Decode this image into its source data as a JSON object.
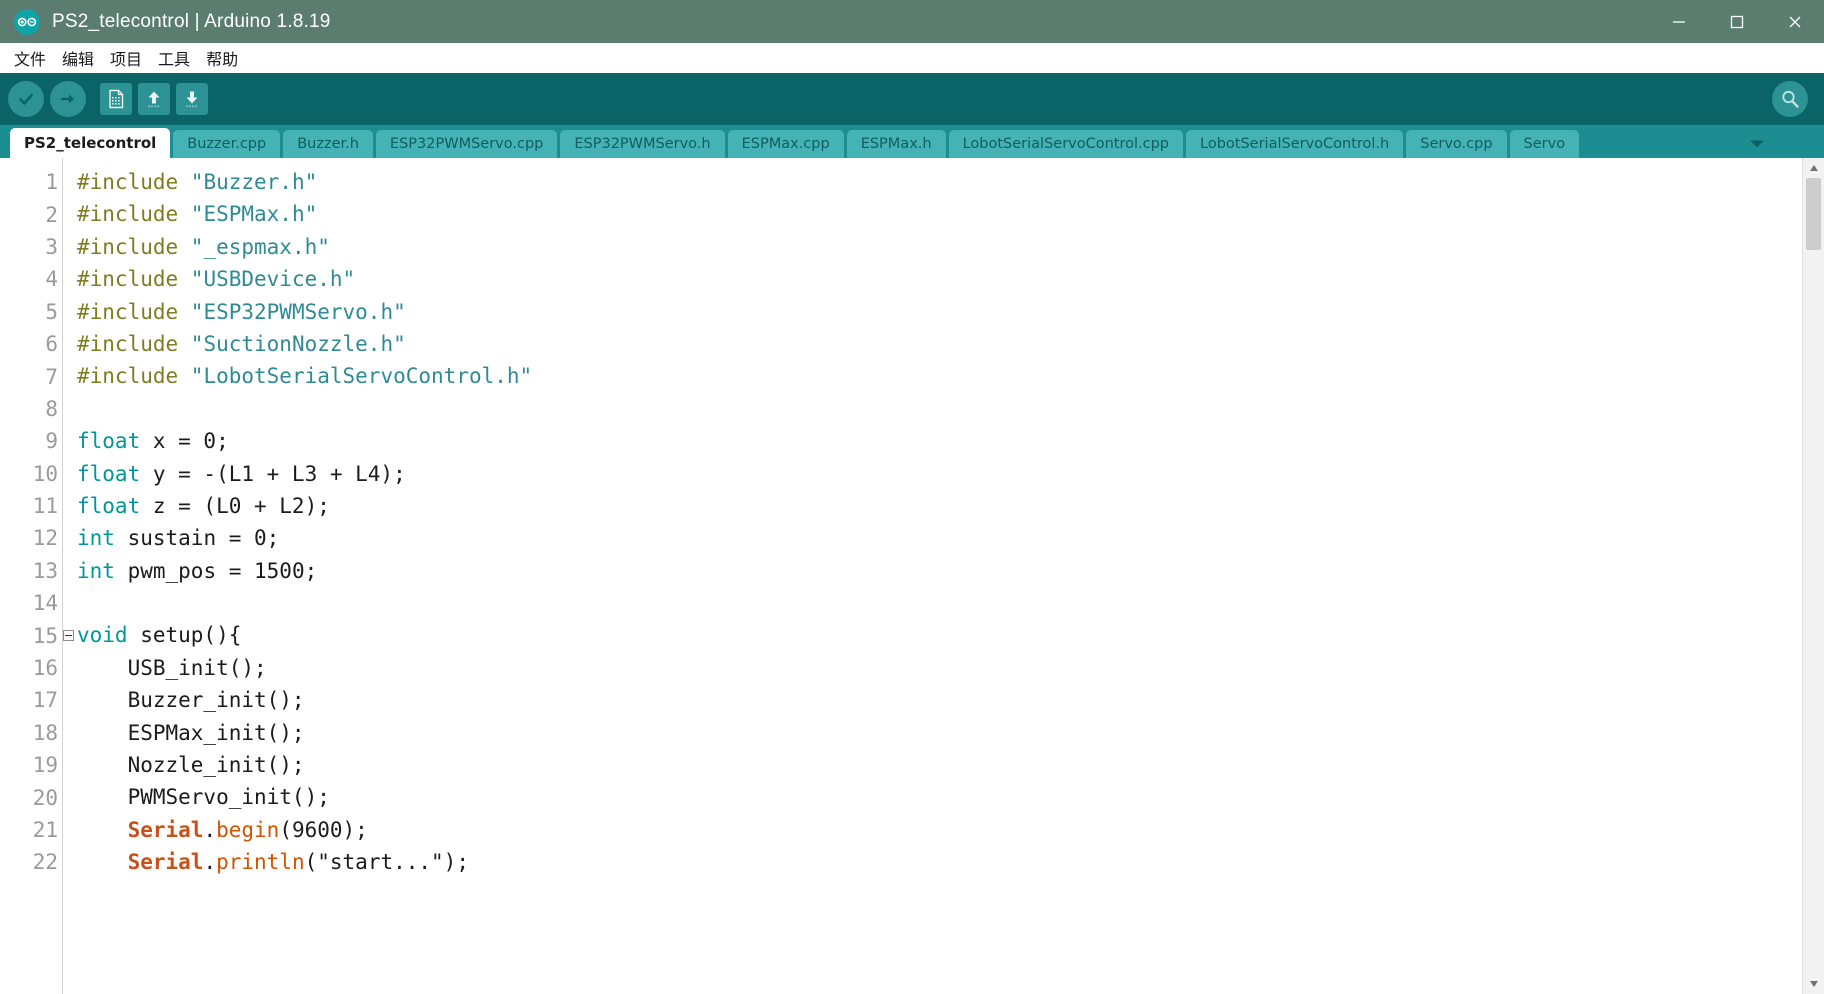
{
  "window": {
    "title": "PS2_telecontrol | Arduino 1.8.19",
    "logo_icon": "arduino-infinity-icon",
    "minimize_icon": "minimize-icon",
    "maximize_icon": "maximize-icon",
    "close_icon": "close-icon",
    "titlebar_color": "#5b7d6f"
  },
  "menubar": {
    "items": [
      {
        "label": "文件",
        "name": "menu-file"
      },
      {
        "label": "编辑",
        "name": "menu-edit"
      },
      {
        "label": "项目",
        "name": "menu-sketch"
      },
      {
        "label": "工具",
        "name": "menu-tools"
      },
      {
        "label": "帮助",
        "name": "menu-help"
      }
    ]
  },
  "toolbar": {
    "background": "#0a6367",
    "buttons": [
      {
        "name": "verify-button",
        "icon": "check-icon",
        "tooltip": "Verify"
      },
      {
        "name": "upload-button",
        "icon": "arrow-right-icon",
        "tooltip": "Upload"
      },
      {
        "name": "new-button",
        "icon": "new-file-icon",
        "tooltip": "New"
      },
      {
        "name": "open-button",
        "icon": "arrow-up-icon",
        "tooltip": "Open"
      },
      {
        "name": "save-button",
        "icon": "arrow-down-icon",
        "tooltip": "Save"
      }
    ],
    "serial_monitor": {
      "name": "serial-monitor-button",
      "icon": "magnifier-icon",
      "tooltip": "Serial Monitor"
    }
  },
  "tabs": {
    "dropdown_icon": "chevron-down-icon",
    "active_index": 0,
    "items": [
      {
        "label": "PS2_telecontrol"
      },
      {
        "label": "Buzzer.cpp"
      },
      {
        "label": "Buzzer.h"
      },
      {
        "label": "ESP32PWMServo.cpp"
      },
      {
        "label": "ESP32PWMServo.h"
      },
      {
        "label": "ESPMax.cpp"
      },
      {
        "label": "ESPMax.h"
      },
      {
        "label": "LobotSerialServoControl.cpp"
      },
      {
        "label": "LobotSerialServoControl.h"
      },
      {
        "label": "Servo.cpp"
      },
      {
        "label": "Servo"
      }
    ]
  },
  "editor": {
    "first_line": 1,
    "lines": [
      {
        "n": "1",
        "fold": false,
        "tokens": [
          {
            "t": "#include ",
            "c": "k-pre"
          },
          {
            "t": "\"Buzzer.h\"",
            "c": "k-str"
          }
        ]
      },
      {
        "n": "2",
        "fold": false,
        "tokens": [
          {
            "t": "#include ",
            "c": "k-pre"
          },
          {
            "t": "\"ESPMax.h\"",
            "c": "k-str"
          }
        ]
      },
      {
        "n": "3",
        "fold": false,
        "tokens": [
          {
            "t": "#include ",
            "c": "k-pre"
          },
          {
            "t": "\"_espmax.h\"",
            "c": "k-str"
          }
        ]
      },
      {
        "n": "4",
        "fold": false,
        "tokens": [
          {
            "t": "#include ",
            "c": "k-pre"
          },
          {
            "t": "\"USBDevice.h\"",
            "c": "k-str"
          }
        ]
      },
      {
        "n": "5",
        "fold": false,
        "tokens": [
          {
            "t": "#include ",
            "c": "k-pre"
          },
          {
            "t": "\"ESP32PWMServo.h\"",
            "c": "k-str"
          }
        ]
      },
      {
        "n": "6",
        "fold": false,
        "tokens": [
          {
            "t": "#include ",
            "c": "k-pre"
          },
          {
            "t": "\"SuctionNozzle.h\"",
            "c": "k-str"
          }
        ]
      },
      {
        "n": "7",
        "fold": false,
        "tokens": [
          {
            "t": "#include ",
            "c": "k-pre"
          },
          {
            "t": "\"LobotSerialServoControl.h\"",
            "c": "k-str"
          }
        ]
      },
      {
        "n": "8",
        "fold": false,
        "tokens": []
      },
      {
        "n": "9",
        "fold": false,
        "tokens": [
          {
            "t": "float",
            "c": "k-type"
          },
          {
            "t": " x = 0;",
            "c": "k-plain"
          }
        ]
      },
      {
        "n": "10",
        "fold": false,
        "tokens": [
          {
            "t": "float",
            "c": "k-type"
          },
          {
            "t": " y = -(L1 + L3 + L4);",
            "c": "k-plain"
          }
        ]
      },
      {
        "n": "11",
        "fold": false,
        "tokens": [
          {
            "t": "float",
            "c": "k-type"
          },
          {
            "t": " z = (L0 + L2);",
            "c": "k-plain"
          }
        ]
      },
      {
        "n": "12",
        "fold": false,
        "tokens": [
          {
            "t": "int",
            "c": "k-type"
          },
          {
            "t": " sustain = 0;",
            "c": "k-plain"
          }
        ]
      },
      {
        "n": "13",
        "fold": false,
        "tokens": [
          {
            "t": "int",
            "c": "k-type"
          },
          {
            "t": " pwm_pos = 1500;",
            "c": "k-plain"
          }
        ]
      },
      {
        "n": "14",
        "fold": false,
        "tokens": []
      },
      {
        "n": "15",
        "fold": true,
        "tokens": [
          {
            "t": "void",
            "c": "k-type"
          },
          {
            "t": " setup(){",
            "c": "k-plain"
          }
        ]
      },
      {
        "n": "16",
        "fold": false,
        "tokens": [
          {
            "t": "    USB_init();",
            "c": "k-plain"
          }
        ]
      },
      {
        "n": "17",
        "fold": false,
        "tokens": [
          {
            "t": "    Buzzer_init();",
            "c": "k-plain"
          }
        ]
      },
      {
        "n": "18",
        "fold": false,
        "tokens": [
          {
            "t": "    ESPMax_init();",
            "c": "k-plain"
          }
        ]
      },
      {
        "n": "19",
        "fold": false,
        "tokens": [
          {
            "t": "    Nozzle_init();",
            "c": "k-plain"
          }
        ]
      },
      {
        "n": "20",
        "fold": false,
        "tokens": [
          {
            "t": "    PWMServo_init();",
            "c": "k-plain"
          }
        ]
      },
      {
        "n": "21",
        "fold": false,
        "tokens": [
          {
            "t": "    ",
            "c": "k-plain"
          },
          {
            "t": "Serial",
            "c": "k-obj"
          },
          {
            "t": ".",
            "c": "k-plain"
          },
          {
            "t": "begin",
            "c": "k-func"
          },
          {
            "t": "(9600);",
            "c": "k-plain"
          }
        ]
      },
      {
        "n": "22",
        "fold": false,
        "tokens": [
          {
            "t": "    ",
            "c": "k-plain"
          },
          {
            "t": "Serial",
            "c": "k-obj"
          },
          {
            "t": ".",
            "c": "k-plain"
          },
          {
            "t": "println",
            "c": "k-func"
          },
          {
            "t": "(\"start...\");",
            "c": "k-plain"
          }
        ]
      }
    ]
  },
  "scrollbar": {
    "up_icon": "caret-up-icon",
    "down_icon": "caret-down-icon",
    "thumb_name": "vertical-scroll-thumb"
  }
}
